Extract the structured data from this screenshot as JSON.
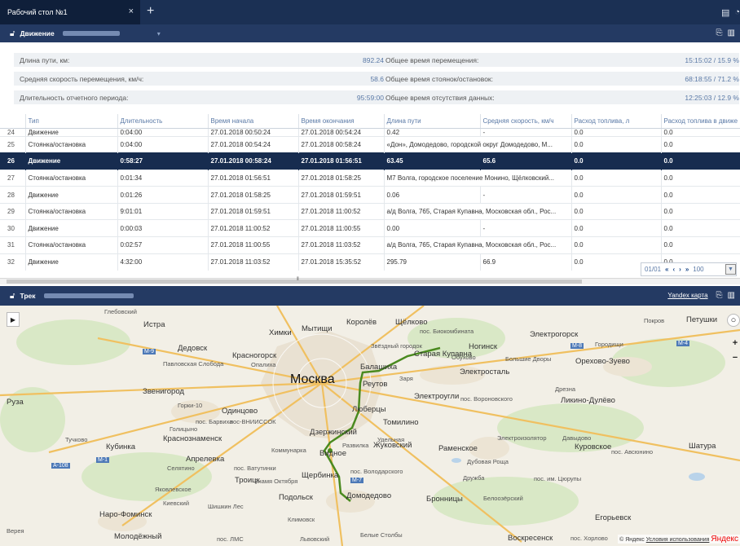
{
  "tab": {
    "title": "Рабочий стол №1",
    "close": "×",
    "add": "+"
  },
  "motion_panel": {
    "title": "Движение",
    "icons": [
      "export-icon",
      "columns-icon"
    ]
  },
  "summary": [
    {
      "label1": "Длина пути, км:",
      "value1": "892.24",
      "label2": "Общее время перемещения:",
      "value2": "15:15:02 / 15.9 %"
    },
    {
      "label1": "Средняя скорость перемещения, км/ч:",
      "value1": "58.6",
      "label2": "Общее время стоянок/остановок:",
      "value2": "68:18:55 / 71.2 %"
    },
    {
      "label1": "Длительность отчетного периода:",
      "value1": "95:59:00",
      "label2": "Общее время отсутствия данных:",
      "value2": "12:25:03 / 12.9 %"
    }
  ],
  "table": {
    "headers": [
      "",
      "Тип",
      "Длительность",
      "Время начала",
      "Время окончания",
      "Длина пути",
      "Средняя скорость, км/ч",
      "Расход топлива, л",
      "Расход топлива в движе"
    ],
    "rows": [
      [
        "24",
        "Движение",
        "0:04:00",
        "27.01.2018 00:50:24",
        "27.01.2018 00:54:24",
        "0.42",
        "-",
        "0.0",
        "0.0"
      ],
      [
        "25",
        "Стоянка/остановка",
        "0:04:00",
        "27.01.2018 00:54:24",
        "27.01.2018 00:58:24",
        "«Дон», Домодедово, городской округ Домодедово, М...",
        "",
        "0.0",
        "0.0"
      ],
      [
        "26",
        "Движение",
        "0:58:27",
        "27.01.2018 00:58:24",
        "27.01.2018 01:56:51",
        "63.45",
        "65.6",
        "0.0",
        "0.0"
      ],
      [
        "27",
        "Стоянка/остановка",
        "0:01:34",
        "27.01.2018 01:56:51",
        "27.01.2018 01:58:25",
        "М7 Волга, городское поселение Монино, Щёлковский...",
        "",
        "0.0",
        "0.0"
      ],
      [
        "28",
        "Движение",
        "0:01:26",
        "27.01.2018 01:58:25",
        "27.01.2018 01:59:51",
        "0.06",
        "-",
        "0.0",
        "0.0"
      ],
      [
        "29",
        "Стоянка/остановка",
        "9:01:01",
        "27.01.2018 01:59:51",
        "27.01.2018 11:00:52",
        "а/д Волга, 765, Старая Купавна, Московская обл., Рос...",
        "",
        "0.0",
        "0.0"
      ],
      [
        "30",
        "Движение",
        "0:00:03",
        "27.01.2018 11:00:52",
        "27.01.2018 11:00:55",
        "0.00",
        "-",
        "0.0",
        "0.0"
      ],
      [
        "31",
        "Стоянка/остановка",
        "0:02:57",
        "27.01.2018 11:00:55",
        "27.01.2018 11:03:52",
        "а/д Волга, 765, Старая Купавна, Московская обл., Рос...",
        "",
        "0.0",
        "0.0"
      ],
      [
        "32",
        "Движение",
        "4:32:00",
        "27.01.2018 11:03:52",
        "27.01.2018 15:35:52",
        "295.79",
        "66.9",
        "0.0",
        "0.0"
      ]
    ],
    "selected_index": 2
  },
  "pager": {
    "page": "01/01",
    "size": "100"
  },
  "track_panel": {
    "title": "Трек",
    "map_link": "Yandex карта"
  },
  "map": {
    "labels": [
      [
        "Глебовский",
        "small"
      ],
      [
        "Истра",
        ""
      ],
      [
        "Химки",
        ""
      ],
      [
        "Мытищи",
        ""
      ],
      [
        "Королёв",
        ""
      ],
      [
        "Щёлково",
        ""
      ],
      [
        "пос. Биокомбината",
        "small"
      ],
      [
        "Электрогорск",
        ""
      ],
      [
        "Петушки",
        ""
      ],
      [
        "Покров",
        "small"
      ],
      [
        "Звёздный городок",
        "small"
      ],
      [
        "Дедовск",
        ""
      ],
      [
        "Красногорск",
        ""
      ],
      [
        "Павловская Слобода",
        "small"
      ],
      [
        "Ногинск",
        ""
      ],
      [
        "Старая Купавна",
        ""
      ],
      [
        "Обухово",
        "small"
      ],
      [
        "Балашиха",
        ""
      ],
      [
        "Большие Дворы",
        "small"
      ],
      [
        "Орехово-Зуево",
        ""
      ],
      [
        "Электросталь",
        ""
      ],
      [
        "Москва",
        "big"
      ],
      [
        "Реутов",
        ""
      ],
      [
        "Заря",
        "small"
      ],
      [
        "Звенигород",
        ""
      ],
      [
        "Руза",
        ""
      ],
      [
        "Горки-10",
        "small"
      ],
      [
        "Одинцово",
        ""
      ],
      [
        "Электроугли",
        ""
      ],
      [
        "пос. Вороновского",
        "small"
      ],
      [
        "Дрезна",
        "small"
      ],
      [
        "Ликино-Дулёво",
        ""
      ],
      [
        "Люберцы",
        ""
      ],
      [
        "Томилино",
        ""
      ],
      [
        "Дзержинский",
        ""
      ],
      [
        "Голицыно",
        "small"
      ],
      [
        "Тучково",
        "small"
      ],
      [
        "Кубинка",
        ""
      ],
      [
        "Краснознаменск",
        ""
      ],
      [
        "Развилка",
        "small"
      ],
      [
        "Жуковский",
        ""
      ],
      [
        "Раменское",
        ""
      ],
      [
        "Давыдово",
        "small"
      ],
      [
        "Куровское",
        ""
      ],
      [
        "Шатура",
        ""
      ],
      [
        "Видное",
        ""
      ],
      [
        "Апрелевка",
        ""
      ],
      [
        "Селятино",
        "small"
      ],
      [
        "пос. Ватутинки",
        "small"
      ],
      [
        "Троицк",
        ""
      ],
      [
        "Щербинка",
        ""
      ],
      [
        "пос. Володарского",
        "small"
      ],
      [
        "Дубовая Роща",
        "small"
      ],
      [
        "Дружба",
        "small"
      ],
      [
        "пос. им. Цюрупы",
        "small"
      ],
      [
        "Яковлевское",
        "small"
      ],
      [
        "Знамя Октября",
        "small"
      ],
      [
        "Подольск",
        ""
      ],
      [
        "Домодедово",
        ""
      ],
      [
        "Бронницы",
        ""
      ],
      [
        "Белоозёрский",
        "small"
      ],
      [
        "Наро-Фоминск",
        ""
      ],
      [
        "Киевский",
        "small"
      ],
      [
        "Шишкин Лес",
        "small"
      ],
      [
        "Климовск",
        "small"
      ],
      [
        "Егорьевск",
        ""
      ],
      [
        "Верея",
        "small"
      ],
      [
        "Молодёжный",
        ""
      ],
      [
        "пос. ЛМС",
        "small"
      ],
      [
        "Львовский",
        "small"
      ],
      [
        "Белые Столбы",
        "small"
      ],
      [
        "Воскресенск",
        ""
      ],
      [
        "пос. Хорлово",
        "small"
      ],
      [
        "пос. Авсюнино",
        "small"
      ],
      [
        "Коммунарка",
        "small"
      ],
      [
        "пос. Барвиха",
        "small"
      ],
      [
        "Опалиха",
        "small"
      ],
      [
        "пос-ВНИИССОК",
        "small"
      ],
      [
        "Электроизолятор",
        "small"
      ],
      [
        "Удельная",
        "small"
      ],
      [
        "Городищи",
        "small"
      ]
    ],
    "roads": [
      "М-9",
      "М-1",
      "А-108",
      "М-7",
      "М-4",
      "М-8"
    ],
    "zoom_in": "+",
    "zoom_out": "−",
    "copyright": "© Яндекс",
    "terms": "Условия использования",
    "yandex": "Яндекс",
    "route_color": "#4a8a1f"
  }
}
